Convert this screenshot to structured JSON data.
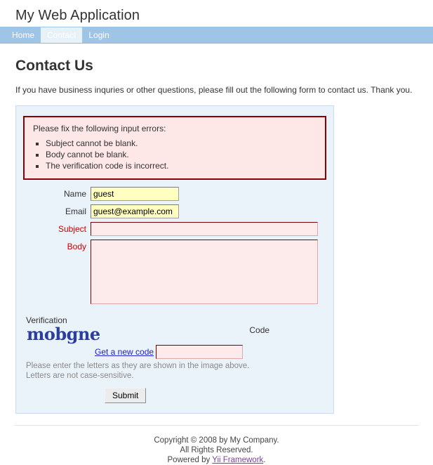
{
  "header": {
    "logo": "My Web Application"
  },
  "mainmenu": {
    "items": [
      {
        "label": "Home",
        "active": false
      },
      {
        "label": "Contact",
        "active": true
      },
      {
        "label": "Login",
        "active": false
      }
    ]
  },
  "content": {
    "page_title": "Contact Us",
    "intro": "If you have business inquries or other questions, please fill out the following form to contact us. Thank you."
  },
  "error_summary": {
    "heading": "Please fix the following input errors:",
    "errors": [
      "Subject cannot be blank.",
      "Body cannot be blank.",
      "The verification code is incorrect."
    ]
  },
  "form": {
    "name": {
      "label": "Name",
      "value": "guest"
    },
    "email": {
      "label": "Email",
      "value": "guest@example.com"
    },
    "subject": {
      "label": "Subject",
      "value": ""
    },
    "body": {
      "label": "Body",
      "value": ""
    },
    "verification": {
      "label_line1": "Verification",
      "label_line2": "Code",
      "captcha_text": "mobgne",
      "refresh_link": "Get a new code",
      "code_value": "",
      "hint_line1": "Please enter the letters as they are shown in the image above.",
      "hint_line2": "Letters are not case-sensitive."
    },
    "submit_label": "Submit"
  },
  "footer": {
    "line1": "Copyright © 2008 by My Company.",
    "line2": "All Rights Reserved.",
    "powered_prefix": "Powered by ",
    "powered_link": "Yii Framework",
    "powered_suffix": "."
  },
  "colors": {
    "nav_bar": "#9ec4e6",
    "nav_active": "#e7f1f8",
    "panel_bg": "#eaf2fa",
    "panel_border": "#c9dcf0",
    "error_border": "#8b0000",
    "error_bg": "#fde7e7",
    "error_text": "#cc0000",
    "field_filled_bg": "#ffffc0",
    "field_error_bg": "#fdeaea",
    "captcha_text": "#2b3d9e",
    "link": "#2222cc",
    "footer_link": "#7b3f9d"
  }
}
